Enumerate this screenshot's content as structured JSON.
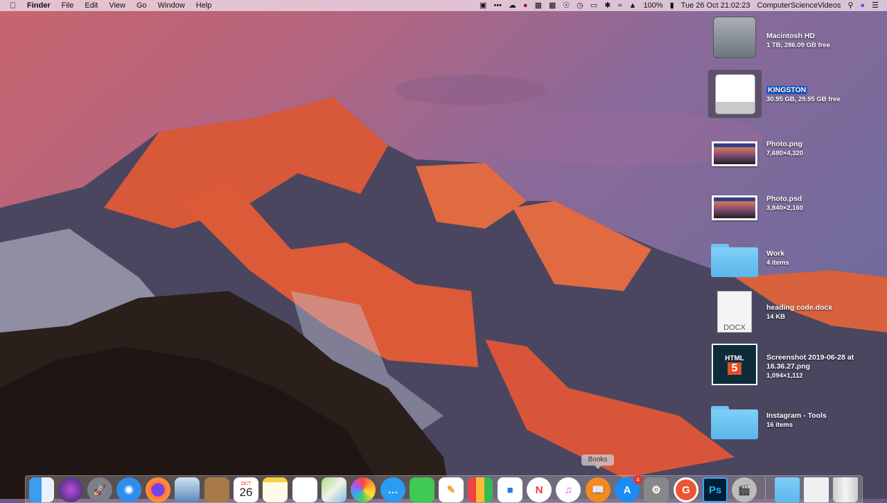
{
  "menubar": {
    "apple_icon": "apple-icon",
    "app_name": "Finder",
    "menus": [
      "File",
      "Edit",
      "View",
      "Go",
      "Window",
      "Help"
    ],
    "battery": "100%",
    "datetime": "Tue 26 Oct  21:02:23",
    "user": "ComputerScienceVideos"
  },
  "desktop": {
    "items": [
      {
        "name": "Macintosh HD",
        "info": "1 TB, 286.09 GB free"
      },
      {
        "name": "KINGSTON",
        "info": "30.95 GB, 29.95 GB free"
      },
      {
        "name": "Photo.png",
        "info": "7,680×4,320"
      },
      {
        "name": "Photo.psd",
        "info": "3,840×2,160"
      },
      {
        "name": "Work",
        "info": "4 items"
      },
      {
        "name": "heading code.docx",
        "info": "14 KB",
        "doc_label": "DOCX"
      },
      {
        "name": "Screenshot 2019-06-28 at",
        "name2": "16.36.27.png",
        "info": "1,094×1,112",
        "thumb_label": "HTML",
        "thumb_num": "5"
      },
      {
        "name": "Instagram - Tools",
        "info": "16 items"
      }
    ]
  },
  "dock": {
    "tooltip": "Books",
    "calendar_month": "OCT",
    "calendar_day": "26",
    "appstore_badge": "4",
    "ps_label": "Ps",
    "grammarly_label": "G"
  }
}
